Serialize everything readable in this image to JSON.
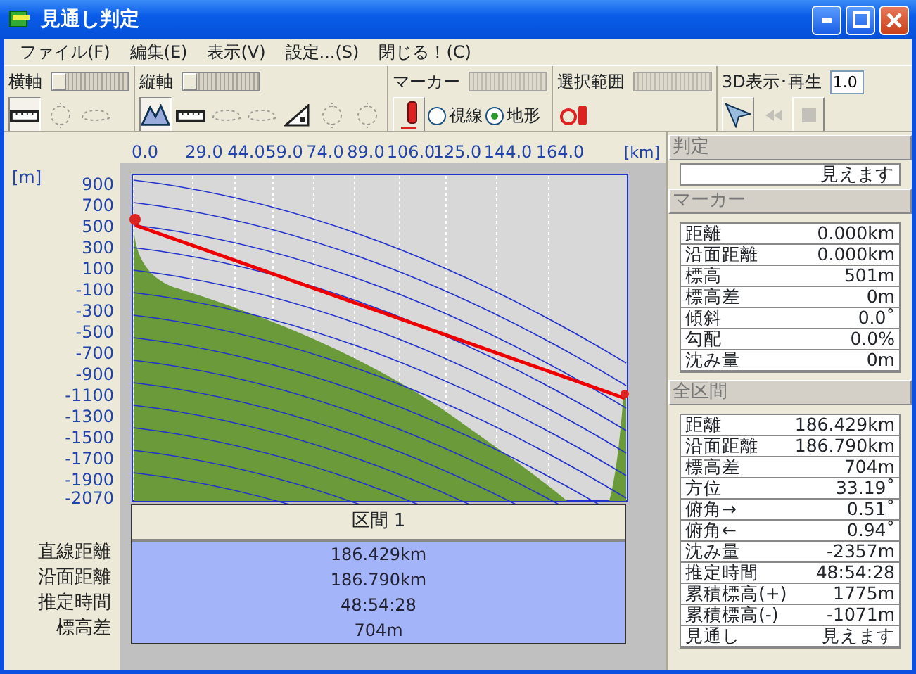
{
  "window": {
    "title": "見通し判定"
  },
  "menu": [
    "ファイル(F)",
    "編集(E)",
    "表示(V)",
    "設定...(S)",
    "閉じる！(C)"
  ],
  "toolbar": [
    {
      "label": "横軸",
      "slider": {
        "disabled": false
      },
      "buttons": [
        {
          "kind": "ruler",
          "selected": true,
          "disabled": false
        },
        {
          "kind": "dotted-circle",
          "selected": false,
          "disabled": true
        },
        {
          "kind": "dotted-cloud",
          "selected": false,
          "disabled": true
        }
      ]
    },
    {
      "label": "縦軸",
      "slider": {
        "disabled": false
      },
      "buttons": [
        {
          "kind": "mountain",
          "selected": true,
          "disabled": false
        },
        {
          "kind": "ruler",
          "selected": false,
          "disabled": false
        },
        {
          "kind": "dotted-cloud",
          "selected": false,
          "disabled": true
        },
        {
          "kind": "dotted-cloud",
          "selected": false,
          "disabled": true
        },
        {
          "kind": "slope",
          "selected": false,
          "disabled": false
        },
        {
          "kind": "dotted-circle",
          "selected": false,
          "disabled": true
        },
        {
          "kind": "dotted-circle",
          "selected": false,
          "disabled": true
        }
      ]
    },
    {
      "label": "マーカー",
      "slider": {
        "disabled": true
      },
      "buttons": [
        {
          "kind": "marker",
          "selected": false,
          "disabled": false
        }
      ],
      "radios": [
        {
          "label": "視線",
          "selected": false
        },
        {
          "label": "地形",
          "selected": true
        }
      ]
    },
    {
      "label": "選択範囲",
      "slider": {
        "disabled": true
      },
      "buttons": [
        {
          "kind": "range-marker",
          "selected": false,
          "disabled": false
        }
      ]
    },
    {
      "label": "3D表示･再生",
      "input": "1.0",
      "buttons": [
        {
          "kind": "plane",
          "selected": false,
          "disabled": false
        },
        {
          "kind": "rewind",
          "selected": false,
          "disabled": true
        },
        {
          "kind": "stop",
          "selected": false,
          "disabled": true
        }
      ]
    }
  ],
  "profile": {
    "x_ticks": [
      "0.0",
      "29.0",
      "44.0",
      "59.0",
      "74.0",
      "89.0",
      "106.0",
      "125.0",
      "144.0",
      "164.0"
    ],
    "x_unit": "[km]",
    "y_unit": "[m]",
    "y_ticks": [
      "900",
      "700",
      "500",
      "300",
      "100",
      "-100",
      "-300",
      "-500",
      "-700",
      "-900",
      "-1100",
      "-1300",
      "-1500",
      "-1700",
      "-1900",
      "-2070"
    ]
  },
  "section": {
    "header": "区間 1",
    "rows": [
      {
        "label": "直線距離",
        "value": "186.429km"
      },
      {
        "label": "沿面距離",
        "value": "186.790km"
      },
      {
        "label": "推定時間",
        "value": "48:54:28"
      },
      {
        "label": "標高差",
        "value": "704m"
      }
    ]
  },
  "judgement": {
    "title": "判定",
    "value": "見えます"
  },
  "marker": {
    "title": "マーカー",
    "rows": [
      {
        "label": "距離",
        "value": "0.000km"
      },
      {
        "label": "沿面距離",
        "value": "0.000km"
      },
      {
        "label": "標高",
        "value": "501m"
      },
      {
        "label": "標高差",
        "value": "0m"
      },
      {
        "label": "傾斜",
        "value": "0.0˚"
      },
      {
        "label": "勾配",
        "value": "0.0%"
      },
      {
        "label": "沈み量",
        "value": "0m"
      }
    ]
  },
  "total": {
    "title": "全区間",
    "rows": [
      {
        "label": "距離",
        "value": "186.429km"
      },
      {
        "label": "沿面距離",
        "value": "186.790km"
      },
      {
        "label": "標高差",
        "value": "704m"
      },
      {
        "label": "方位",
        "value": "33.19˚"
      },
      {
        "label": "俯角→",
        "value": "0.51˚"
      },
      {
        "label": "俯角←",
        "value": "0.94˚"
      },
      {
        "label": "沈み量",
        "value": "-2357m"
      },
      {
        "label": "推定時間",
        "value": "48:54:28"
      },
      {
        "label": "累積標高(+)",
        "value": "1775m"
      },
      {
        "label": "累積標高(-)",
        "value": "-1071m"
      },
      {
        "label": "見通し",
        "value": "見えます"
      }
    ]
  }
}
